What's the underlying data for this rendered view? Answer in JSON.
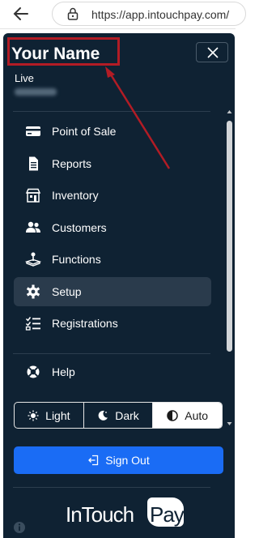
{
  "browser": {
    "url": "https://app.intouchpay.com/",
    "icons": {
      "back": "back-arrow-icon",
      "security": "lock-icon"
    }
  },
  "panel": {
    "title": "Your Name",
    "status": "Live",
    "annotation_color": "#b21c25"
  },
  "menu": {
    "items": [
      {
        "label": "Point of Sale",
        "icon": "credit-card-icon",
        "active": false
      },
      {
        "label": "Reports",
        "icon": "document-icon",
        "active": false
      },
      {
        "label": "Inventory",
        "icon": "store-icon",
        "active": false
      },
      {
        "label": "Customers",
        "icon": "users-icon",
        "active": false
      },
      {
        "label": "Functions",
        "icon": "joystick-icon",
        "active": false
      },
      {
        "label": "Setup",
        "icon": "gear-icon",
        "active": true
      },
      {
        "label": "Registrations",
        "icon": "checklist-icon",
        "active": false
      },
      {
        "label": "Help",
        "icon": "lifebuoy-icon",
        "active": false
      }
    ]
  },
  "theme": {
    "options": [
      {
        "label": "Light",
        "icon": "sun-icon"
      },
      {
        "label": "Dark",
        "icon": "moon-icon"
      },
      {
        "label": "Auto",
        "icon": "half-circle-icon",
        "selected": true
      }
    ]
  },
  "signout": {
    "label": "Sign Out",
    "icon": "sign-out-icon"
  },
  "logo": {
    "text_main": "InTouch",
    "text_badge": "Pay"
  },
  "colors": {
    "panel_bg": "#0f2233",
    "active_item_bg": "#2a3b4c",
    "primary_button": "#1a6cf5",
    "annotation_red": "#b21c25"
  }
}
